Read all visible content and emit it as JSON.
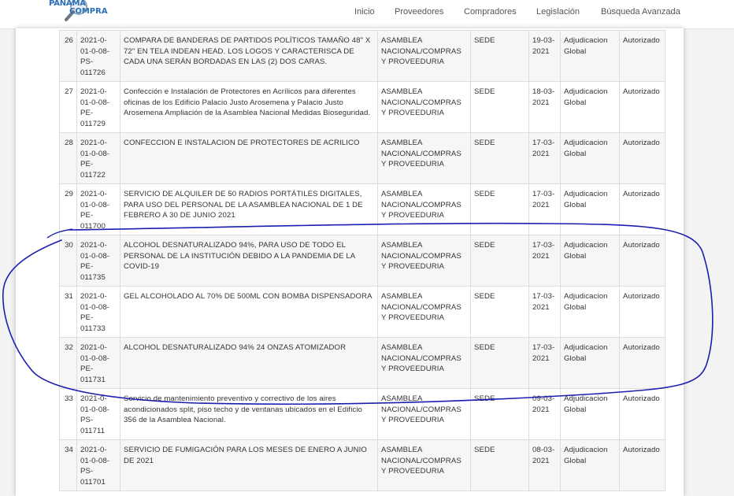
{
  "header": {
    "logo_text_top": "PANAMA",
    "logo_text_bottom": "COMPRA",
    "nav": [
      "Inicio",
      "Proveedores",
      "Compradores",
      "Legislación",
      "Búsqueda Avanzada"
    ]
  },
  "colors": {
    "link": "#2f72b4",
    "annotation": "#1a1fb0"
  },
  "table": {
    "rows": [
      {
        "n": "26",
        "code": "2021-0-01-0-08-PS-011726",
        "desc": "COMPARA DE BANDERAS DE PARTIDOS POLÍTICOS TAMAÑO 48\" X 72\" EN TELA INDEAN HEAD. LOS LOGOS Y CARACTERISCA DE CADA UNA SERÁN BORDADAS EN LAS (2) DOS CARAS.",
        "entity": "ASAMBLEA NACIONAL/COMPRAS Y PROVEEDURIA",
        "site": "SEDE",
        "date": "19-03-2021",
        "type": "Adjudicacion Global",
        "status": "Autorizado"
      },
      {
        "n": "27",
        "code": "2021-0-01-0-08-PE-011729",
        "desc": "Confección e Instalación de Protectores en Acrílicos para diferentes oficinas de los Edificio Palacio Justo Arosemena y Palacio Justo Arosemena Ampliación de la Asamblea Nacional Medidas Bioseguridad.",
        "entity": "ASAMBLEA NACIONAL/COMPRAS Y PROVEEDURIA",
        "site": "SEDE",
        "date": "18-03-2021",
        "type": "Adjudicacion Global",
        "status": "Autorizado"
      },
      {
        "n": "28",
        "code": "2021-0-01-0-08-PE-011722",
        "desc": "CONFECCION E INSTALACION DE PROTECTORES DE ACRILICO",
        "entity": "ASAMBLEA NACIONAL/COMPRAS Y PROVEEDURIA",
        "site": "SEDE",
        "date": "17-03-2021",
        "type": "Adjudicacion Global",
        "status": "Autorizado"
      },
      {
        "n": "29",
        "code": "2021-0-01-0-08-PE-011700",
        "desc": "SERVICIO DE ALQUILER DE 50 RADIOS PORTÁTILES DIGITALES, PARA USO DEL PERSONAL DE LA ASAMBLEA NACIONAL DE 1 DE FEBRERO A 30 DE JUNIO 2021",
        "entity": "ASAMBLEA NACIONAL/COMPRAS Y PROVEEDURIA",
        "site": "SEDE",
        "date": "17-03-2021",
        "type": "Adjudicacion Global",
        "status": "Autorizado"
      },
      {
        "n": "30",
        "code": "2021-0-01-0-08-PE-011735",
        "desc": "ALCOHOL DESNATURALIZADO 94%, PARA USO DE TODO EL PERSONAL DE LA INSTITUCIÓN DEBIDO A LA PANDEMIA DE LA COVID-19",
        "entity": "ASAMBLEA NACIONAL/COMPRAS Y PROVEEDURIA",
        "site": "SEDE",
        "date": "17-03-2021",
        "type": "Adjudicacion Global",
        "status": "Autorizado"
      },
      {
        "n": "31",
        "code": "2021-0-01-0-08-PE-011733",
        "desc": "GEL ALCOHOLADO AL 70% DE 500ML CON BOMBA DISPENSADORA",
        "entity": "ASAMBLEA NACIONAL/COMPRAS Y PROVEEDURIA",
        "site": "SEDE",
        "date": "17-03-2021",
        "type": "Adjudicacion Global",
        "status": "Autorizado"
      },
      {
        "n": "32",
        "code": "2021-0-01-0-08-PE-011731",
        "desc": "ALCOHOL DESNATURALIZADO 94% 24 ONZAS ATOMIZADOR",
        "entity": "ASAMBLEA NACIONAL/COMPRAS Y PROVEEDURIA",
        "site": "SEDE",
        "date": "17-03-2021",
        "type": "Adjudicacion Global",
        "status": "Autorizado"
      },
      {
        "n": "33",
        "code": "2021-0-01-0-08-PS-011711",
        "desc": "Servicio de mantenimiento preventivo y correctivo de los aires acondicionados split, piso techo y de ventanas ubicados en el Edificio 356 de la Asamblea Nacional.",
        "entity": "ASAMBLEA NACIONAL/COMPRAS Y PROVEEDURIA",
        "site": "SEDE",
        "date": "09-03-2021",
        "type": "Adjudicacion Global",
        "status": "Autorizado"
      },
      {
        "n": "34",
        "code": "2021-0-01-0-08-PS-011701",
        "desc": "SERVICIO DE FUMIGACIÓN PARA LOS MESES DE ENERO A JUNIO DE 2021",
        "entity": "ASAMBLEA NACIONAL/COMPRAS Y PROVEEDURIA",
        "site": "SEDE",
        "date": "08-03-2021",
        "type": "Adjudicacion Global",
        "status": "Autorizado"
      }
    ]
  }
}
